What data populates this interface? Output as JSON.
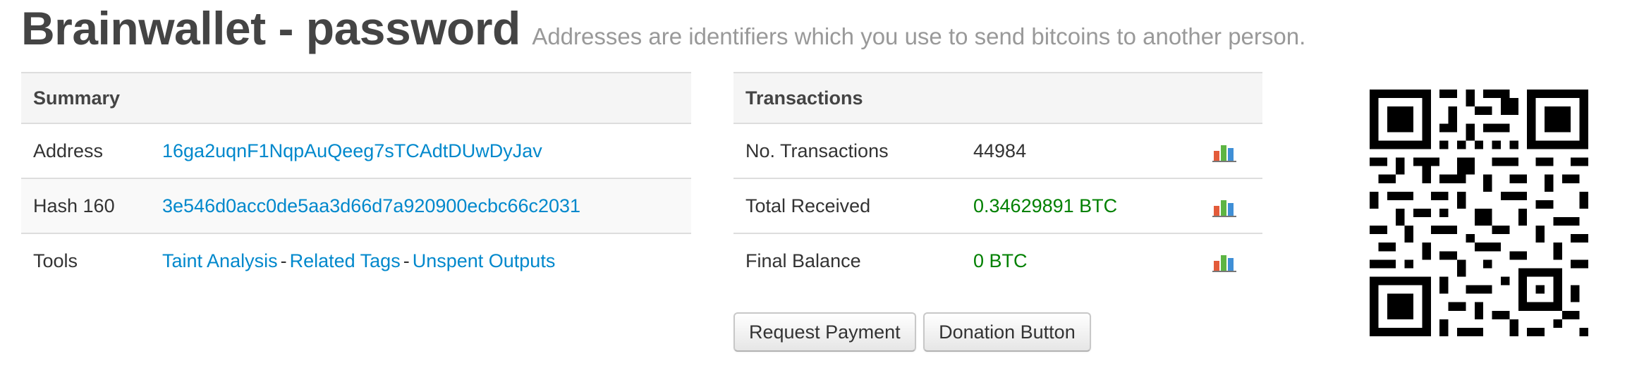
{
  "header": {
    "title": "Brainwallet - password",
    "subtitle": "Addresses are identifiers which you use to send bitcoins to another person."
  },
  "summary": {
    "heading": "Summary",
    "address_label": "Address",
    "address_value": "16ga2uqnF1NqpAuQeeg7sTCAdtDUwDyJav",
    "hash_label": "Hash 160",
    "hash_value": "3e546d0acc0de5aa3d66d7a920900ecbc66c2031",
    "tools_label": "Tools",
    "tools": {
      "taint": "Taint Analysis",
      "related": "Related Tags",
      "unspent": "Unspent Outputs",
      "separator": "-"
    }
  },
  "transactions": {
    "heading": "Transactions",
    "rows": [
      {
        "label": "No. Transactions",
        "value": "44984",
        "icon": "bar-chart-icon"
      },
      {
        "label": "Total Received",
        "value": "0.34629891 BTC",
        "icon": "bar-chart-icon"
      },
      {
        "label": "Final Balance",
        "value": "0 BTC",
        "icon": "bar-chart-icon"
      }
    ]
  },
  "buttons": {
    "request_payment": "Request Payment",
    "donation_button": "Donation Button"
  },
  "colors": {
    "link": "#0088cc",
    "positive_value": "#008000",
    "title": "#444444",
    "subtitle": "#999999"
  },
  "qr_icon": "qr-code"
}
